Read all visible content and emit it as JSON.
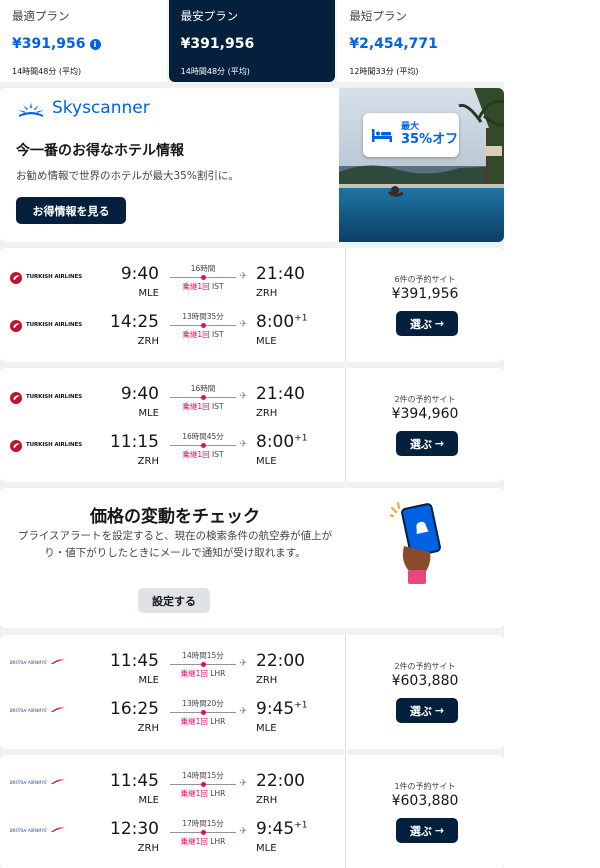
{
  "tabs": [
    {
      "label": "最適プラン",
      "price": "¥391,956",
      "duration": "14時間48分 (平均)",
      "active": false
    },
    {
      "label": "最安プラン",
      "price": "¥391,956",
      "duration": "14時間48分 (平均)",
      "active": true
    },
    {
      "label": "最短プラン",
      "price": "¥2,454,771",
      "duration": "12時間33分 (平均)",
      "active": false
    }
  ],
  "ad": {
    "brand": "Skyscanner",
    "title": "今一番のお得なホテル情報",
    "description": "お勧め情報で世界のホテルが最大35%割引に。",
    "button": "お得情報を見る",
    "badge_small": "最大",
    "badge_big": "35%オフ"
  },
  "cards": [
    {
      "airline": "TURKISH AIRLINES",
      "legs": [
        {
          "dep_time": "9:40",
          "dep_code": "MLE",
          "duration": "16時間",
          "stops": "乗継1回",
          "via": "IST",
          "arr_time": "21:40",
          "arr_plus": "",
          "arr_code": "ZRH"
        },
        {
          "dep_time": "14:25",
          "dep_code": "ZRH",
          "duration": "13時間35分",
          "stops": "乗継1回",
          "via": "IST",
          "arr_time": "8:00",
          "arr_plus": "+1",
          "arr_code": "MLE"
        }
      ],
      "offers": "6件の予約サイト",
      "price": "¥391,956",
      "select": "選ぶ"
    },
    {
      "airline": "TURKISH AIRLINES",
      "legs": [
        {
          "dep_time": "9:40",
          "dep_code": "MLE",
          "duration": "16時間",
          "stops": "乗継1回",
          "via": "IST",
          "arr_time": "21:40",
          "arr_plus": "",
          "arr_code": "ZRH"
        },
        {
          "dep_time": "11:15",
          "dep_code": "ZRH",
          "duration": "16時間45分",
          "stops": "乗継1回",
          "via": "IST",
          "arr_time": "8:00",
          "arr_plus": "+1",
          "arr_code": "MLE"
        }
      ],
      "offers": "2件の予約サイト",
      "price": "¥394,960",
      "select": "選ぶ"
    },
    {
      "airline": "BRITISH AIRWAYS",
      "legs": [
        {
          "dep_time": "11:45",
          "dep_code": "MLE",
          "duration": "14時間15分",
          "stops": "乗継1回",
          "via": "LHR",
          "arr_time": "22:00",
          "arr_plus": "",
          "arr_code": "ZRH"
        },
        {
          "dep_time": "16:25",
          "dep_code": "ZRH",
          "duration": "13時間20分",
          "stops": "乗継1回",
          "via": "LHR",
          "arr_time": "9:45",
          "arr_plus": "+1",
          "arr_code": "MLE"
        }
      ],
      "offers": "2件の予約サイト",
      "price": "¥603,880",
      "select": "選ぶ"
    },
    {
      "airline": "BRITISH AIRWAYS",
      "legs": [
        {
          "dep_time": "11:45",
          "dep_code": "MLE",
          "duration": "14時間15分",
          "stops": "乗継1回",
          "via": "LHR",
          "arr_time": "22:00",
          "arr_plus": "",
          "arr_code": "ZRH"
        },
        {
          "dep_time": "12:30",
          "dep_code": "ZRH",
          "duration": "17時間15分",
          "stops": "乗継1回",
          "via": "LHR",
          "arr_time": "9:45",
          "arr_plus": "+1",
          "arr_code": "MLE"
        }
      ],
      "offers": "1件の予約サイト",
      "price": "¥603,880",
      "select": "選ぶ"
    }
  ],
  "alert": {
    "title": "価格の変動をチェック",
    "description": "プライスアラートを設定すると、現在の検索条件の航空券が値上がり・値下がりしたときにメールで通知が受け取れます。",
    "button": "設定する"
  },
  "colors": {
    "primary": "#0062e3",
    "dark": "#05203c",
    "stop_red": "#e70866"
  }
}
